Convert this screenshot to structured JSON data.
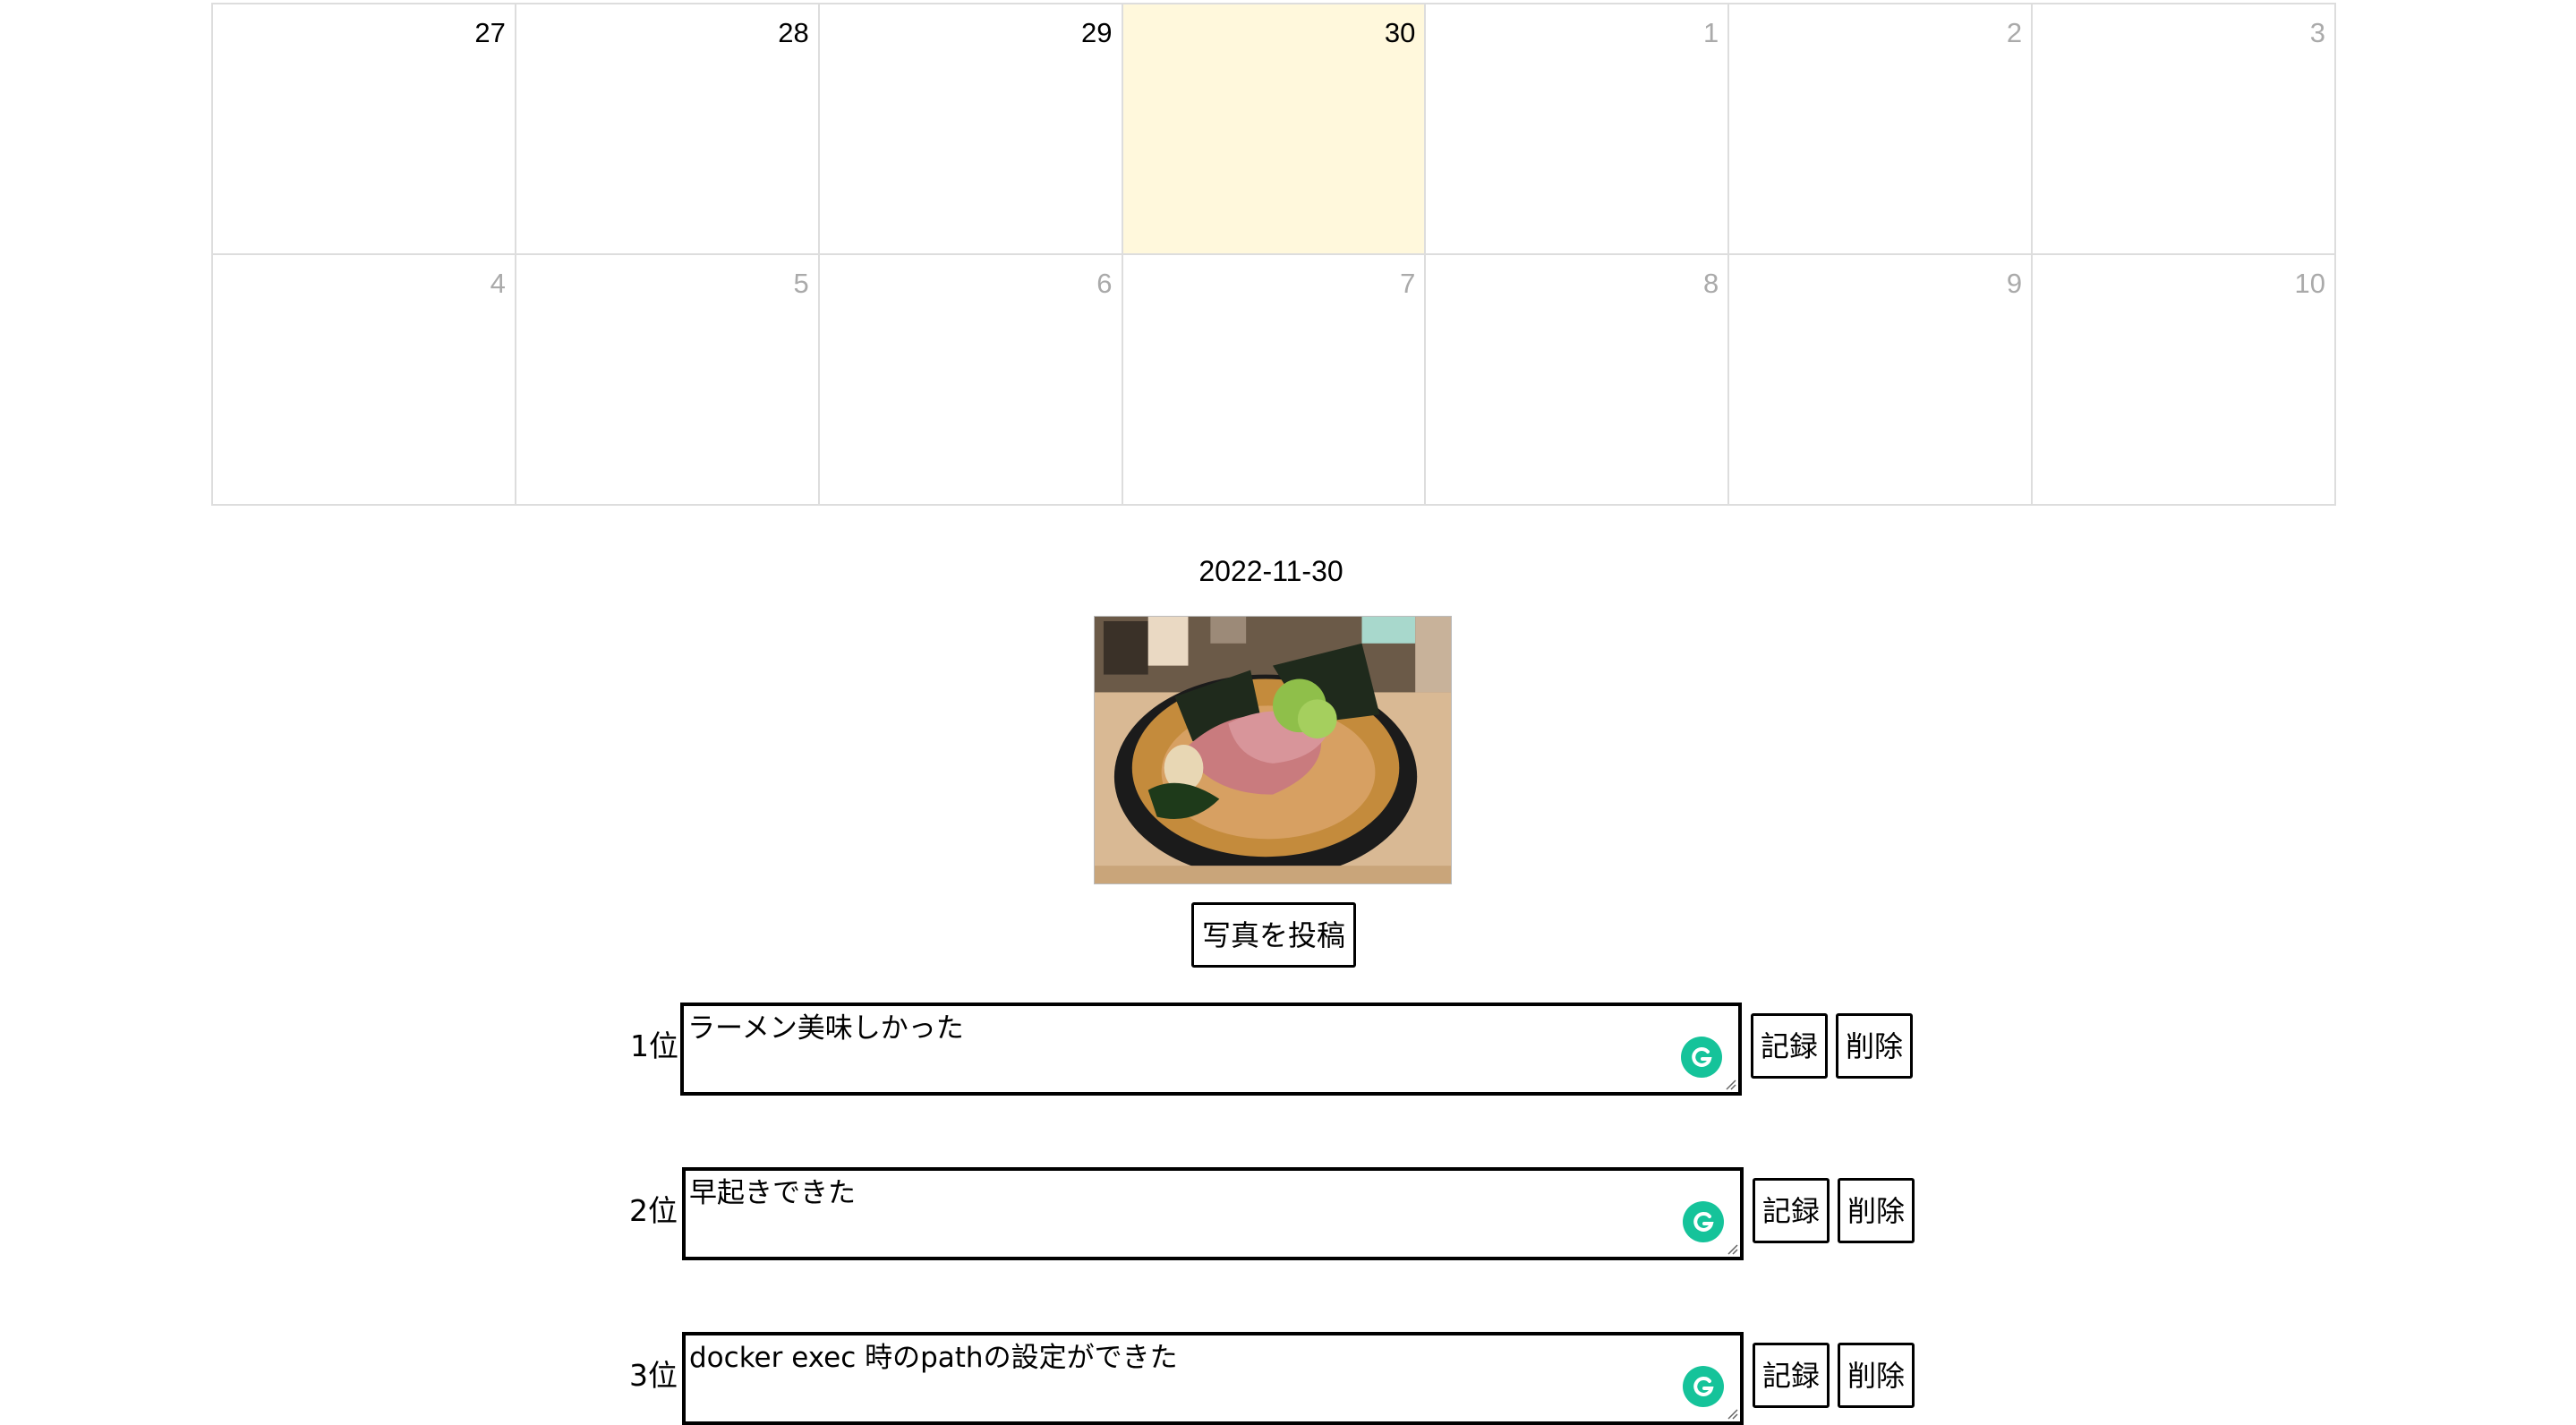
{
  "calendar": {
    "weeks": [
      [
        {
          "day": "27",
          "other": false,
          "today": false
        },
        {
          "day": "28",
          "other": false,
          "today": false
        },
        {
          "day": "29",
          "other": false,
          "today": false
        },
        {
          "day": "30",
          "other": false,
          "today": true
        },
        {
          "day": "1",
          "other": true,
          "today": false
        },
        {
          "day": "2",
          "other": true,
          "today": false
        },
        {
          "day": "3",
          "other": true,
          "today": false
        }
      ],
      [
        {
          "day": "4",
          "other": true,
          "today": false
        },
        {
          "day": "5",
          "other": true,
          "today": false
        },
        {
          "day": "6",
          "other": true,
          "today": false
        },
        {
          "day": "7",
          "other": true,
          "today": false
        },
        {
          "day": "8",
          "other": true,
          "today": false
        },
        {
          "day": "9",
          "other": true,
          "today": false
        },
        {
          "day": "10",
          "other": true,
          "today": false
        }
      ]
    ],
    "today_color": "#fff8dc",
    "other_month_color": "#aaaaaa"
  },
  "selected_date": "2022-11-30",
  "photo": {
    "icon": "ramen-photo"
  },
  "post_photo_label": "写真を投稿",
  "rankings": [
    {
      "rank": "1位",
      "text": "ラーメン美味しかった",
      "save_label": "記録",
      "delete_label": "削除"
    },
    {
      "rank": "2位",
      "text": "早起きできた",
      "save_label": "記録",
      "delete_label": "削除"
    },
    {
      "rank": "3位",
      "text": "docker exec 時のpathの設定ができた",
      "save_label": "記録",
      "delete_label": "削除"
    }
  ],
  "grammarly_color": "#15c39a"
}
